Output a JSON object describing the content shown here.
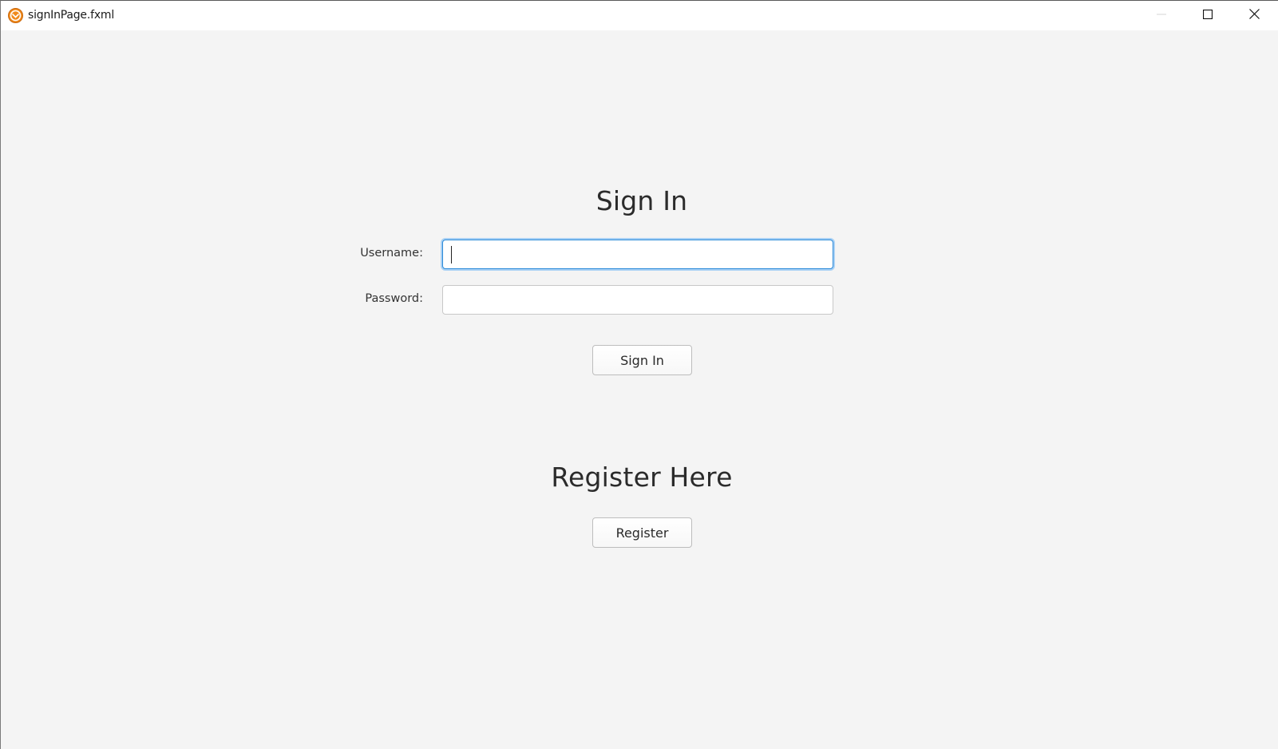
{
  "window": {
    "title": "signInPage.fxml",
    "app_icon": "app-logo-icon",
    "controls": [
      "minimize-icon",
      "maximize-icon",
      "close-icon"
    ]
  },
  "sign_in": {
    "heading": "Sign In",
    "username_label": "Username:",
    "username_value": "",
    "password_label": "Password:",
    "password_value": "",
    "button_label": "Sign In"
  },
  "register": {
    "heading": "Register Here",
    "button_label": "Register"
  },
  "colors": {
    "background": "#f4f4f4",
    "focus_border": "#2b8ad8",
    "focus_ring": "#a9d1f5",
    "app_icon": "#f08a1c"
  }
}
